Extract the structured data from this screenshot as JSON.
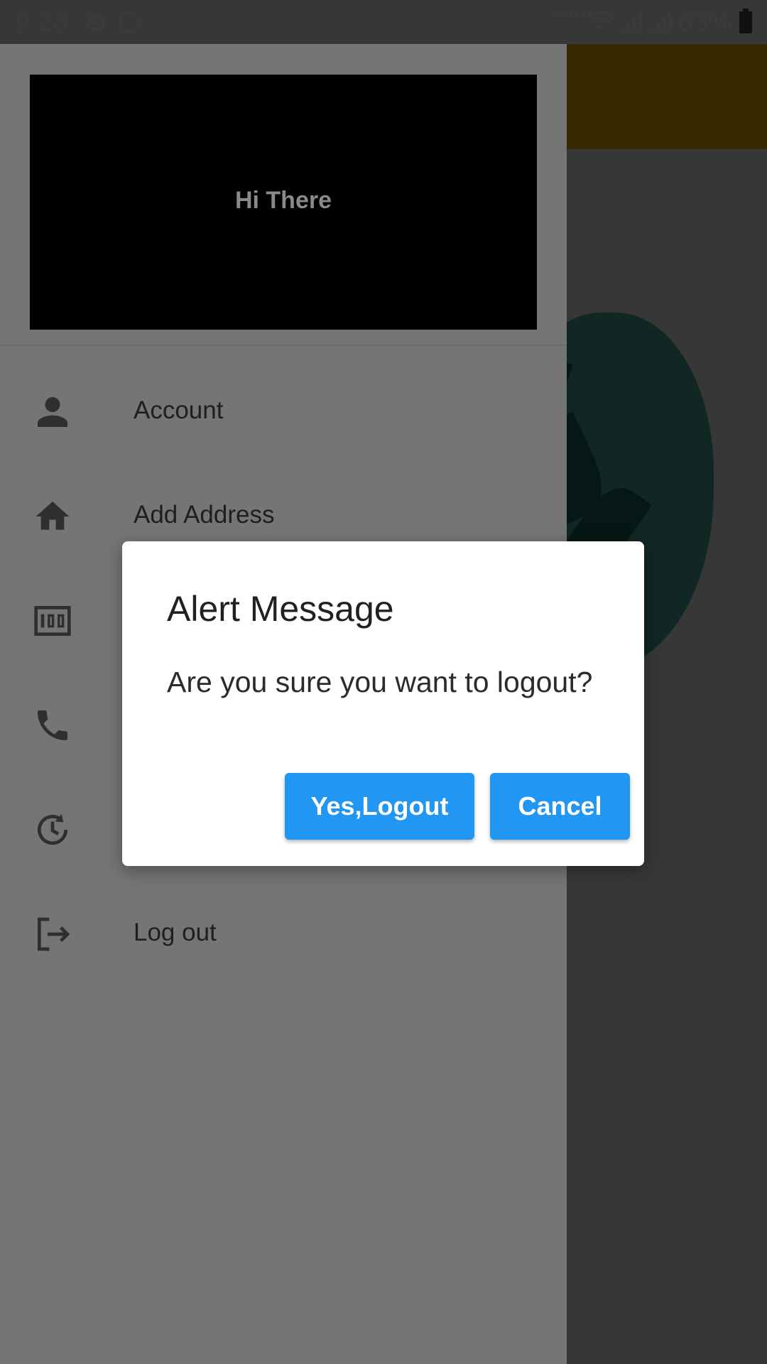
{
  "status_bar": {
    "time": "9:28",
    "network_label": "Vo)) LTE",
    "battery": "63%"
  },
  "drawer": {
    "header_text": "Hi There",
    "items": [
      {
        "label": "Account",
        "icon": "person-icon"
      },
      {
        "label": "Add Address",
        "icon": "home-icon"
      },
      {
        "label": "",
        "icon": "score-100-icon"
      },
      {
        "label": "",
        "icon": "phone-icon"
      },
      {
        "label": "",
        "icon": "history-icon"
      },
      {
        "label": "Log out",
        "icon": "logout-icon"
      }
    ]
  },
  "background": {
    "partial_text": "s",
    "appbar_color": "#ffbf00"
  },
  "dialog": {
    "title": "Alert Message",
    "message": "Are you sure you want to logout?",
    "confirm_label": "Yes,Logout",
    "cancel_label": "Cancel",
    "button_color": "#2196f3"
  }
}
